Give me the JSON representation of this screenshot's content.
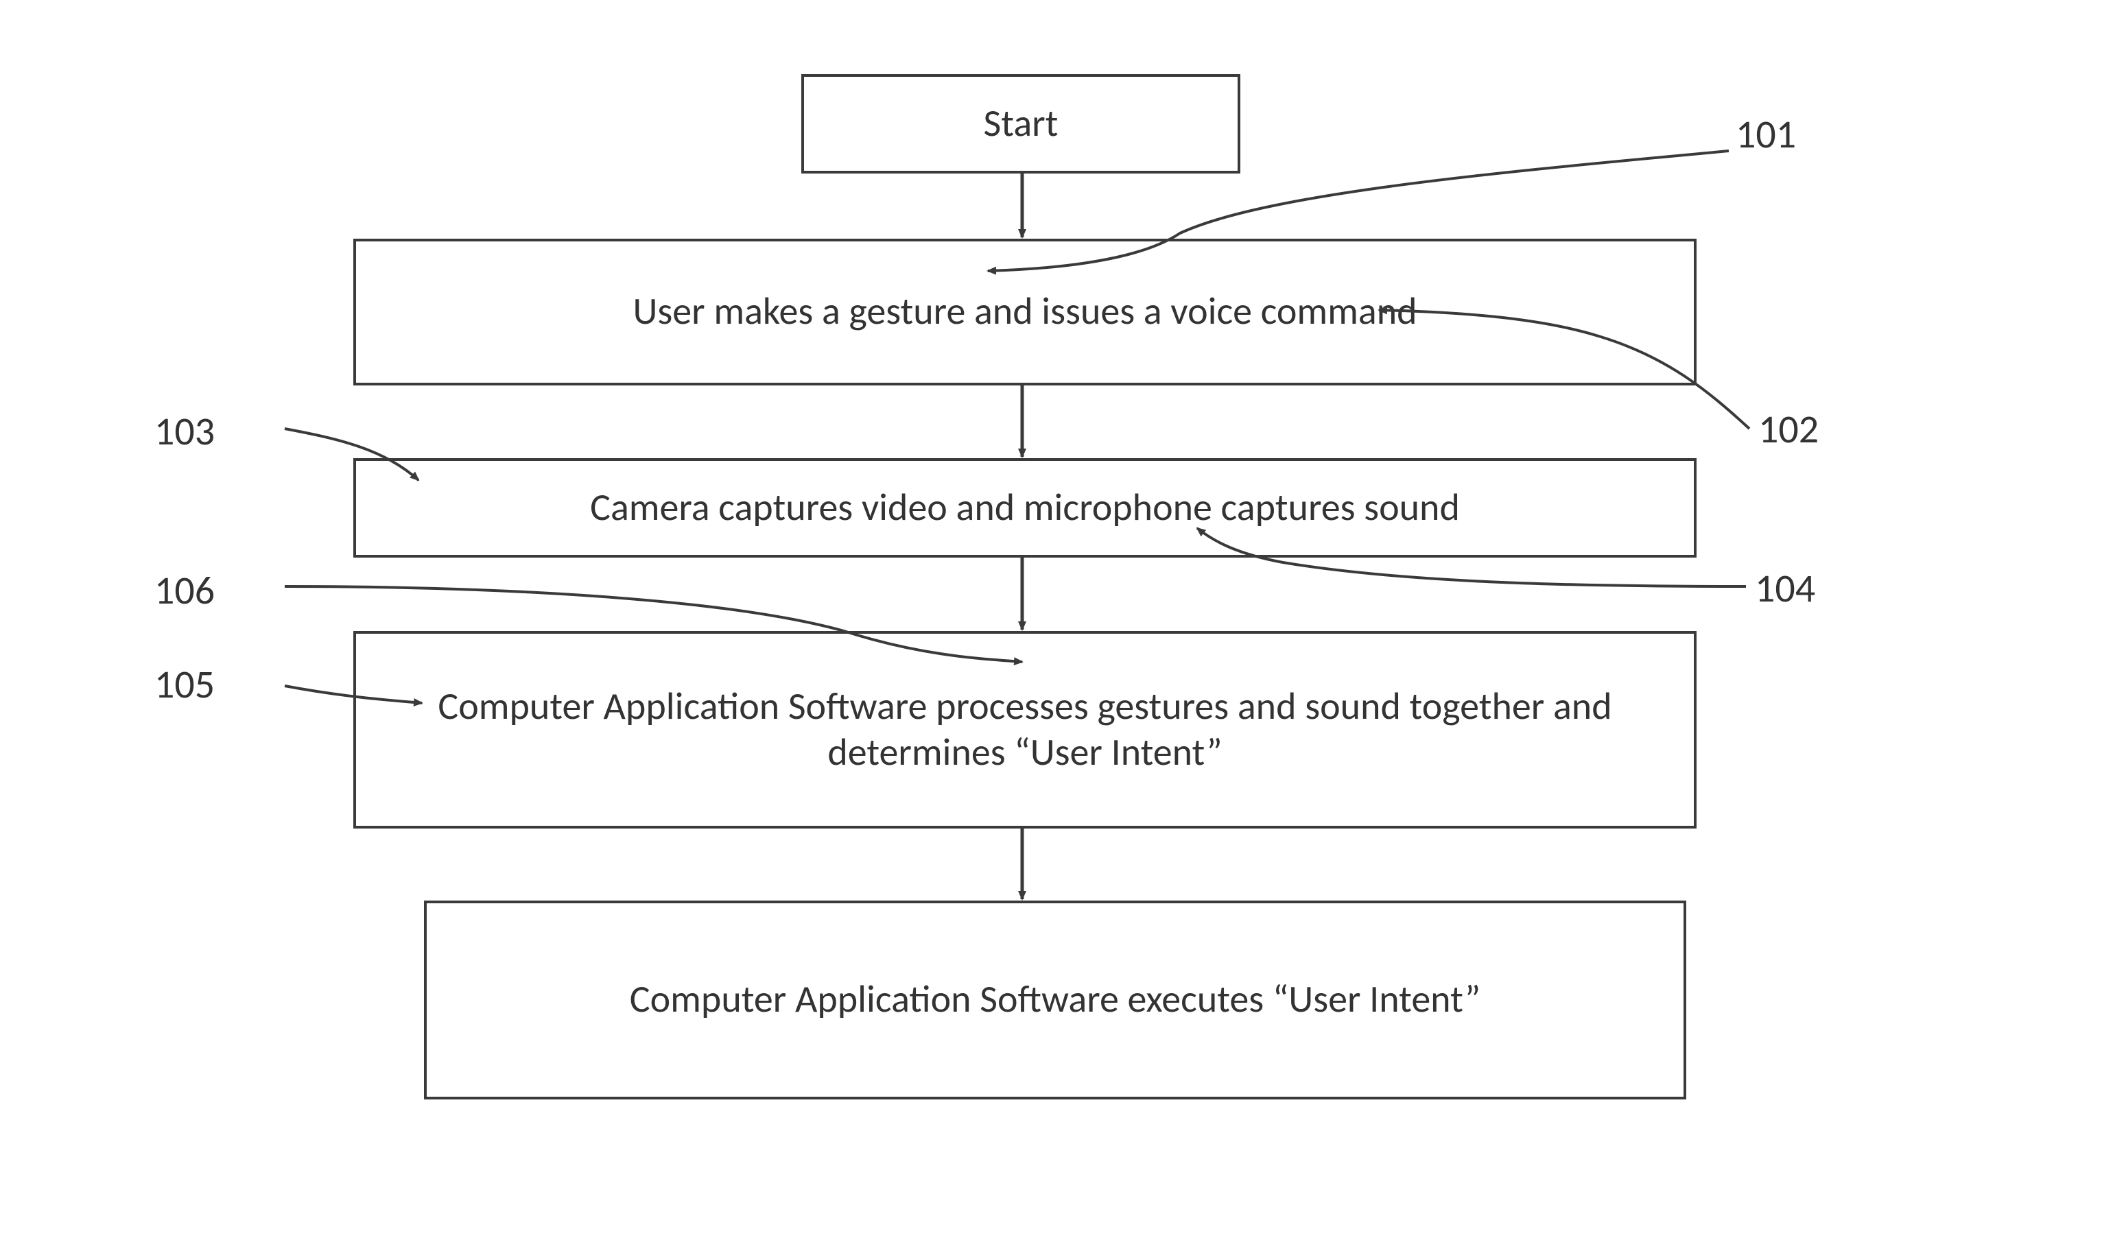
{
  "boxes": {
    "start": "Start",
    "step1": "User makes a gesture and issues a voice command",
    "step2": "Camera captures video and microphone captures sound",
    "step3": "Computer Application Software processes gestures and sound together and determines “User Intent”",
    "step4": "Computer Application Software executes “User Intent”"
  },
  "labels": {
    "l101": "101",
    "l102": "102",
    "l103": "103",
    "l104": "104",
    "l105": "105",
    "l106": "106"
  }
}
